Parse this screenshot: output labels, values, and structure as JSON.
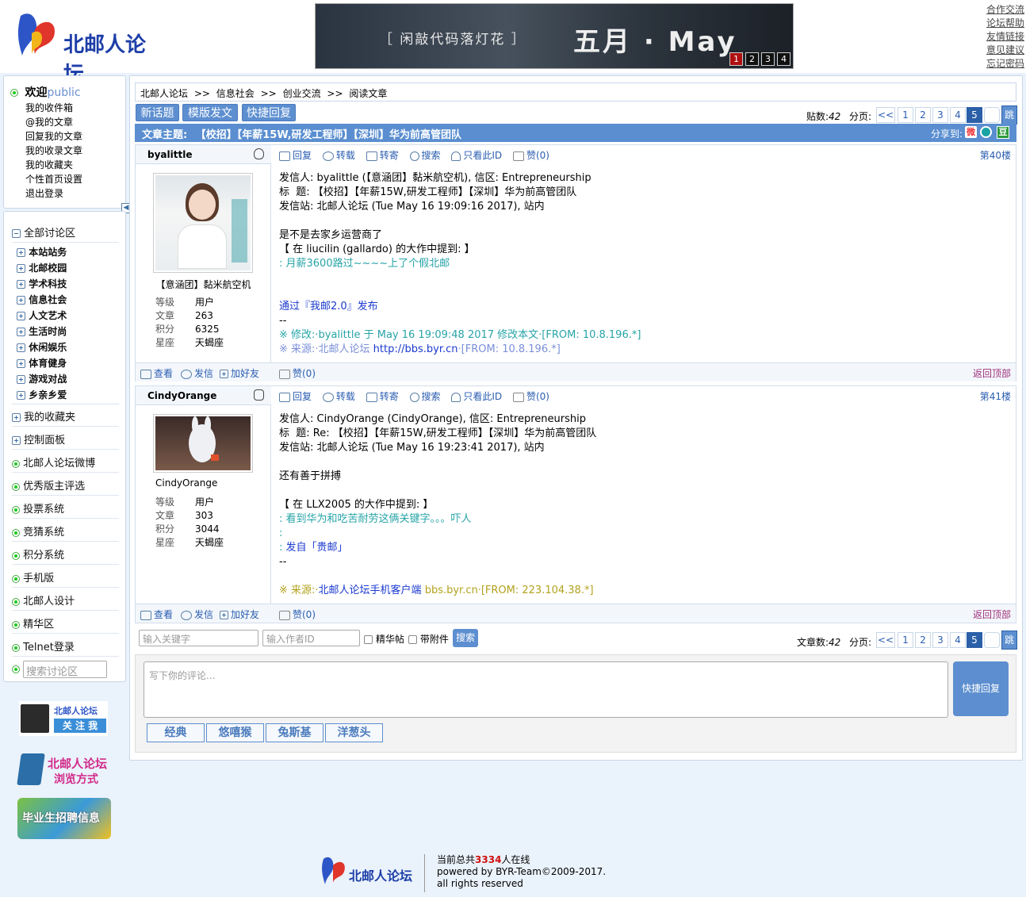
{
  "header": {
    "logo_text": "北邮人论坛",
    "banner": {
      "slogan": "［ 闲敲代码落灯花 ］",
      "month": "五月  ·  May",
      "pages": [
        "1",
        "2",
        "3",
        "4"
      ]
    },
    "toplinks": [
      "合作交流",
      "论坛帮助",
      "友情链接",
      "意见建议",
      "忘记密码"
    ]
  },
  "userbox": {
    "welcome": "欢迎",
    "username": "public",
    "links": [
      "我的收件箱",
      "@我的文章",
      "回复我的文章",
      "我的收录文章",
      "我的收藏夹",
      "个性首页设置",
      "退出登录"
    ]
  },
  "nav": {
    "all": "全部讨论区",
    "sections": [
      "本站站务",
      "北邮校园",
      "学术科技",
      "信息社会",
      "人文艺术",
      "生活时尚",
      "休闲娱乐",
      "体育健身",
      "游戏对战",
      "乡亲乡爱"
    ],
    "fav": "我的收藏夹",
    "control": "控制面板",
    "items": [
      "北邮人论坛微博",
      "优秀版主评选",
      "投票系统",
      "竞猜系统",
      "积分系统",
      "手机版",
      "北邮人设计",
      "精华区",
      "Telnet登录"
    ],
    "search_placeholder": "搜索讨论区"
  },
  "promos": {
    "weibo_top": "北邮人论坛",
    "weibo_btn": "关 注 我",
    "browse1": "北邮人论坛",
    "browse2": "浏览方式",
    "jobs": "毕业生招聘信息"
  },
  "crumb": [
    "北邮人论坛",
    ">>",
    "信息社会",
    ">>",
    "创业交流",
    ">>",
    "阅读文章"
  ],
  "toolbar": {
    "new_topic": "新话题",
    "template": "模版发文",
    "quick_reply": "快捷回复"
  },
  "pager": {
    "posts_label": "贴数:",
    "posts": "42",
    "articles_label": "文章数:",
    "pages_label": "分页:",
    "prev": "<<",
    "pages": [
      "1",
      "2",
      "3",
      "4",
      "5"
    ],
    "jump": "跳"
  },
  "title": {
    "label": "文章主题:",
    "text": "【校招】【年薪15W,研发工程师】【深圳】华为前高管团队",
    "share": "分享到:"
  },
  "actions": {
    "reply": "回复",
    "forward": "转载",
    "mail": "转寄",
    "search": "搜索",
    "only": "只看此ID",
    "like": "赞(0)",
    "view": "查看",
    "msg": "发信",
    "friend": "加好友",
    "top": "返回顶部"
  },
  "stat_labels": {
    "level": "等级",
    "articles": "文章",
    "score": "积分",
    "sign": "星座"
  },
  "posts": [
    {
      "user": "byalittle",
      "nick": "【意涵团】黏米航空机",
      "level": "用户",
      "articles": "263",
      "score": "6325",
      "sign": "天蝎座",
      "floor": "第40楼",
      "l1": "发信人: byalittle (【意涵团】黏米航空机), 信区: Entrepreneurship",
      "l2": "标  题: 【校招】【年薪15W,研发工程师】【深圳】华为前高管团队",
      "l3": "发信站: 北邮人论坛 (Tue May 16 19:09:16 2017), 站内",
      "l4": "是不是去家乡运营商了",
      "l5": "【 在 liucilin (gallardo) 的大作中提到: 】",
      "l6": ": 月薪3600路过~~~~上了个假北邮",
      "l7": "通过『我邮2.0』发布",
      "l8": "--",
      "l9": "※ 修改:·byalittle 于 May 16 19:09:48 2017 修改本文·[FROM: 10.8.196.*]",
      "l10a": "※ 来源:·北邮人论坛 ",
      "l10b": "http://bbs.byr.cn",
      "l10c": "·[FROM: 10.8.196.*]"
    },
    {
      "user": "CindyOrange",
      "nick": "CindyOrange",
      "level": "用户",
      "articles": "303",
      "score": "3044",
      "sign": "天蝎座",
      "floor": "第41楼",
      "l1": "发信人: CindyOrange (CindyOrange), 信区: Entrepreneurship",
      "l2": "标  题: Re: 【校招】【年薪15W,研发工程师】【深圳】华为前高管团队",
      "l3": "发信站: 北邮人论坛 (Tue May 16 19:23:41 2017), 站内",
      "l4": "还有善于拼搏",
      "l5": "【 在 LLX2005 的大作中提到: 】",
      "l6": ": 看到华为和吃苦耐劳这俩关键字。。。吓人",
      "l7": ":",
      "l8a": ": ",
      "l8b": "发自「贵邮」",
      "l9": "--",
      "l10a": "※ 来源:·",
      "l10b": "北邮人论坛手机客户端",
      "l10c": " bbs.byr.cn·[FROM: 223.104.38.*]"
    }
  ],
  "search": {
    "kw": "输入关键字",
    "author": "输入作者ID",
    "digest": "精华帖",
    "attach": "带附件",
    "btn": "搜索"
  },
  "reply": {
    "placeholder": "写下你的评论...",
    "btn": "快捷回复",
    "emotes": [
      "经典",
      "悠嘻猴",
      "兔斯基",
      "洋葱头"
    ]
  },
  "footer": {
    "online_pre": "当前总共",
    "online": "3334",
    "online_post": "人在线",
    "powered": "powered by BYR-Team©2009-2017.",
    "rights": "all rights reserved",
    "logo": "北邮人论坛"
  }
}
